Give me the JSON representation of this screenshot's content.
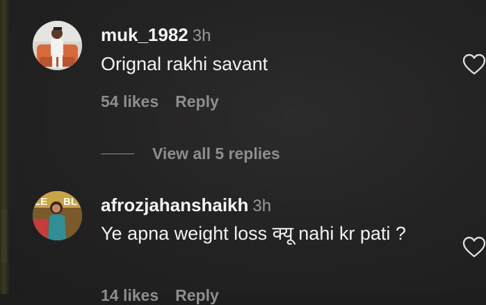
{
  "comments": [
    {
      "username": "muk_1982",
      "time": "3h",
      "text": "Orignal rakhi savant",
      "likes": "54 likes",
      "reply_label": "Reply"
    },
    {
      "username": "afrozjahanshaikh",
      "time": "3h",
      "text": "Ye apna weight loss क्यू nahi kr pati ?",
      "likes": "14 likes",
      "reply_label": "Reply"
    }
  ],
  "view_replies": "View all 5 replies",
  "icons": {
    "like": "heart-outline-icon"
  },
  "colors": {
    "background": "#232222",
    "text": "#f4f4f4",
    "muted": "#8e8e8e"
  }
}
